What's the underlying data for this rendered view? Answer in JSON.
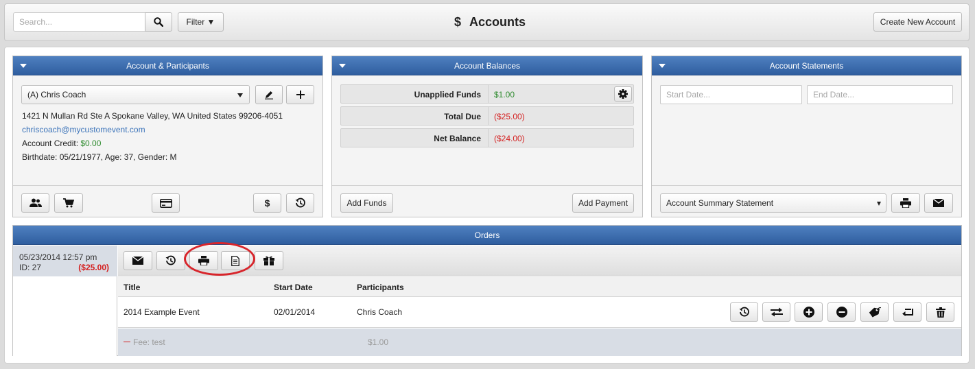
{
  "topbar": {
    "search_placeholder": "Search...",
    "filter_label": "Filter ▼",
    "title_icon": "$",
    "title": "Accounts",
    "create_label": "Create New Account"
  },
  "account_panel": {
    "header": "Account & Participants",
    "selected_participant": "(A) Chris Coach",
    "address": "1421 N Mullan Rd Ste A  Spokane Valley, WA United States 99206-4051",
    "email": "chriscoach@mycustomevent.com",
    "credit_label": "Account Credit: ",
    "credit_value": "$0.00",
    "birth_line": "Birthdate: 05/21/1977,  Age: 37,  Gender: M",
    "footer_dollar": "$"
  },
  "balances_panel": {
    "header": "Account Balances",
    "rows": [
      {
        "label": "Unapplied Funds",
        "value": "$1.00",
        "color": "#2e8b2e"
      },
      {
        "label": "Total Due",
        "value": "($25.00)",
        "color": "#d42020"
      },
      {
        "label": "Net Balance",
        "value": "($24.00)",
        "color": "#d42020"
      }
    ],
    "add_funds_label": "Add Funds",
    "add_payment_label": "Add Payment"
  },
  "statements_panel": {
    "header": "Account Statements",
    "start_placeholder": "Start Date...",
    "end_placeholder": "End Date...",
    "statement_type": "Account Summary Statement"
  },
  "orders": {
    "header": "Orders",
    "selected": {
      "datetime": "05/23/2014 12:57 pm",
      "id": "ID: 27",
      "amount": "($25.00)"
    },
    "columns": [
      "Title",
      "Start Date",
      "Participants"
    ],
    "row": {
      "title": "2014 Example Event",
      "start_date": "02/01/2014",
      "participants": "Chris Coach"
    },
    "fee": {
      "label": "Fee: test",
      "amount": "$1.00"
    }
  },
  "colors": {
    "header_blue": "#3a6aab",
    "negative": "#d42020",
    "positive": "#2e8b2e",
    "highlight_ring": "#d8252b"
  }
}
